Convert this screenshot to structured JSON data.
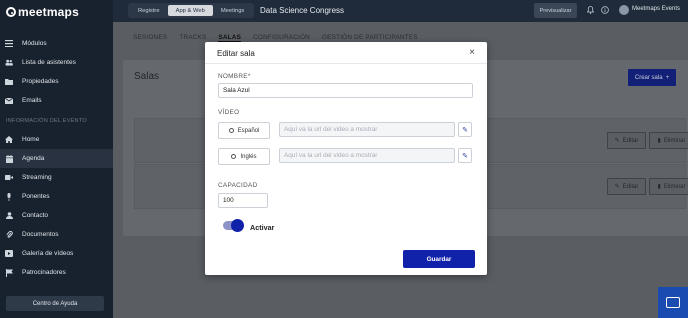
{
  "brand": {
    "logo_text": "meetmaps"
  },
  "sidebar": {
    "items": [
      {
        "label": "Módulos",
        "icon": "menu-icon"
      },
      {
        "label": "Lista de asistentes",
        "icon": "users-icon"
      },
      {
        "label": "Propiedades",
        "icon": "folder-icon"
      },
      {
        "label": "Emails",
        "icon": "mail-icon"
      }
    ],
    "section_label": "INFORMACIÓN DEL EVENTO",
    "event_items": [
      {
        "label": "Home",
        "icon": "home-icon"
      },
      {
        "label": "Agenda",
        "icon": "calendar-icon",
        "active": true
      },
      {
        "label": "Streaming",
        "icon": "streaming-icon"
      },
      {
        "label": "Ponentes",
        "icon": "microphone-icon"
      },
      {
        "label": "Contacto",
        "icon": "contact-icon"
      },
      {
        "label": "Documentos",
        "icon": "paperclip-icon"
      },
      {
        "label": "Galería de vídeos",
        "icon": "video-icon"
      },
      {
        "label": "Patrocinadores",
        "icon": "flag-icon"
      }
    ],
    "help_button": "Centro de Ayuda"
  },
  "topbar": {
    "tabs": [
      "Registre",
      "App & Web",
      "Meetings"
    ],
    "active_tab": "App & Web",
    "event_title": "Data Science Congress",
    "preview_button": "Previsualizar",
    "user_name": "Meetmaps Events"
  },
  "main": {
    "subtabs": [
      "SESIONES",
      "TRACKS",
      "SALAS",
      "CONFIGURACIÓN",
      "GESTIÓN DE PARTICIPANTES"
    ],
    "active_subtab": "SALAS",
    "card_title": "Salas",
    "create_button": "Crear sala",
    "row_edit": "Editar",
    "row_delete": "Eliminar"
  },
  "modal": {
    "title": "Editar sala",
    "name_label": "NOMBRE*",
    "name_value": "Sala Azul",
    "video_label": "VÍDEO",
    "video_rows": [
      {
        "language": "Español",
        "placeholder": "Aquí va la url del video a mostrar"
      },
      {
        "language": "Inglés",
        "placeholder": "Aquí va la url del video a mostrar"
      }
    ],
    "capacity_label": "CAPACIDAD",
    "capacity_value": "100",
    "toggle_label": "Activar",
    "toggle_on": true,
    "save_button": "Guardar"
  },
  "colors": {
    "primary": "#1122aa",
    "sidebar_bg": "#18212e",
    "chat_bubble": "#1a4bb0"
  }
}
